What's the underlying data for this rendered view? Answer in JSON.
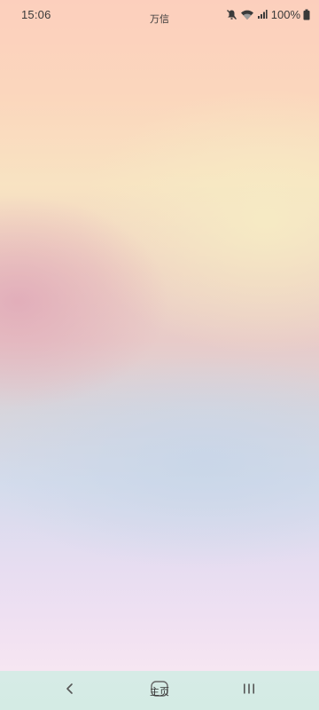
{
  "status_bar": {
    "time": "15:06",
    "center_text": "万信",
    "battery_percent": "100%",
    "icons": [
      "mute-icon",
      "wifi-icon",
      "signal-icon",
      "battery-icon"
    ]
  },
  "nav_bar": {
    "home_label": "主页",
    "buttons": [
      "back-icon",
      "home-icon",
      "recents-icon"
    ]
  },
  "colors": {
    "top": "#fccfbd",
    "middle_pink": "#e0a8b8",
    "middle_yellow": "#f6ecc4",
    "lower_blue": "#d4dcec",
    "bottom_lilac": "#f2e2f2",
    "nav_bar_bg": "#d6ebe6"
  }
}
